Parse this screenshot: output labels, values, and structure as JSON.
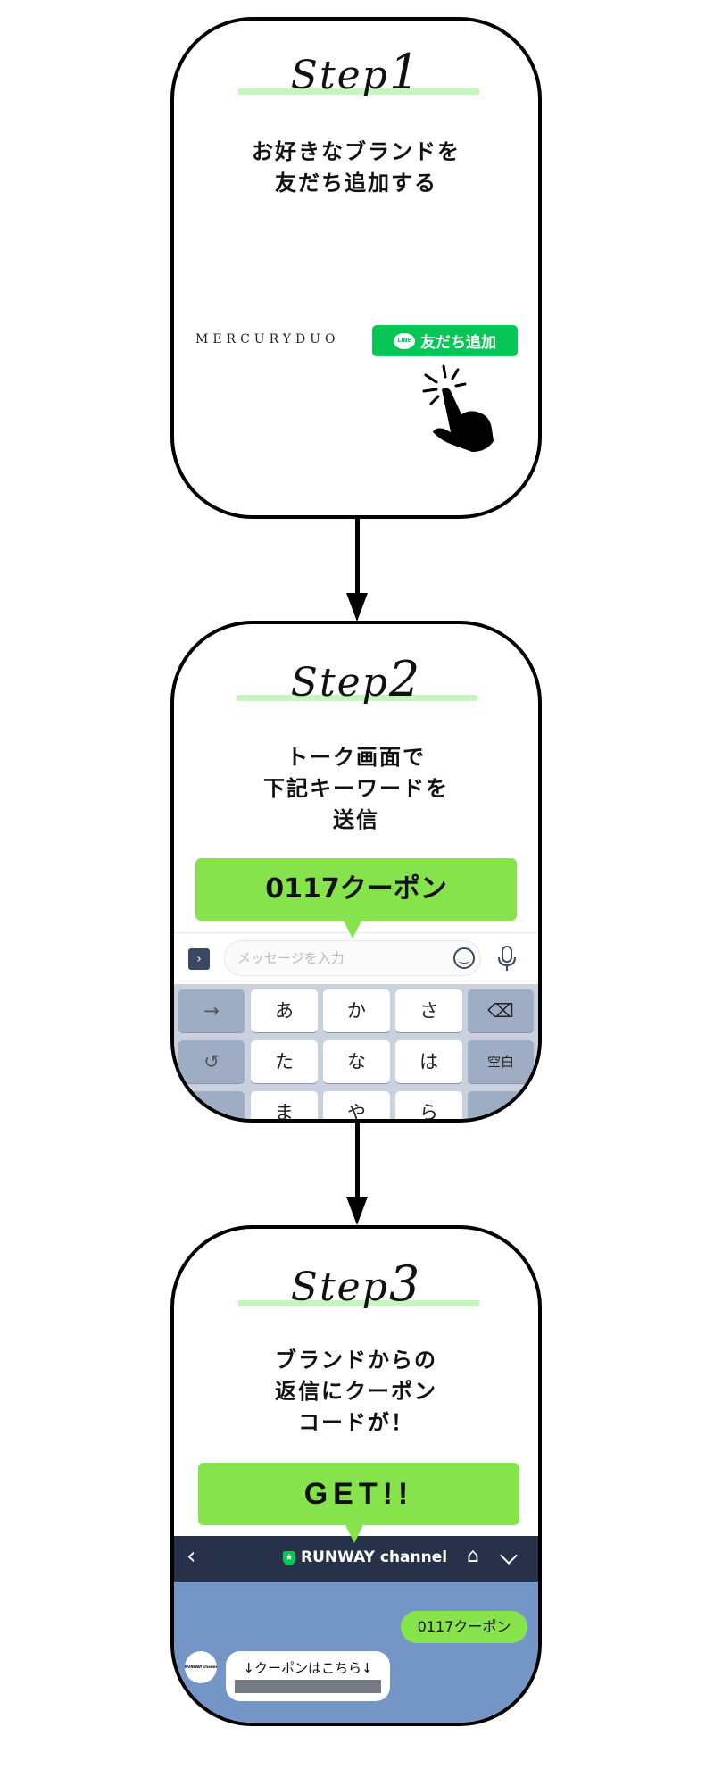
{
  "steps": [
    {
      "label": "Step",
      "num": "1",
      "lines": [
        "お好きなブランドを",
        "友だち追加する"
      ]
    },
    {
      "label": "Step",
      "num": "2",
      "lines": [
        "トーク画面で",
        "下記キーワードを",
        "送信"
      ]
    },
    {
      "label": "Step",
      "num": "3",
      "lines": [
        "ブランドからの",
        "返信にクーポン",
        "コードが！"
      ]
    }
  ],
  "step1": {
    "brand": "MERCURYDUO",
    "add_friend_button": "友だち追加",
    "line_badge": "LINE"
  },
  "step2": {
    "keyword": "0117クーポン",
    "input_placeholder": "メッセージを入力",
    "keys": [
      [
        "→",
        "あ",
        "か",
        "さ",
        "⌫"
      ],
      [
        "↺",
        "た",
        "な",
        "は",
        "空白"
      ],
      [
        "",
        "ま",
        "や",
        "ら",
        ""
      ]
    ]
  },
  "step3": {
    "get_label": "GET!!",
    "channel_name": "RUNWAY channel",
    "sent_message": "0117クーポン",
    "reply_message": "↓クーポンはこちら↓",
    "avatar_text": "RUNWAY channel"
  },
  "colors": {
    "accent_green": "#86e34b",
    "line_green": "#06c755",
    "highlight": "#c6f5c0",
    "chat_header": "#27324a",
    "chat_bg": "#7396c6"
  }
}
